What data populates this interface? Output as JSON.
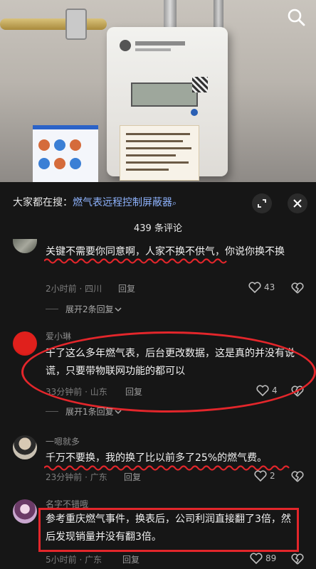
{
  "search_bar": {
    "prefix": "大家都在搜：",
    "query": "燃气表远程控制屏蔽器"
  },
  "comment_count": "439 条评论",
  "comments": [
    {
      "text": "关键不需要你同意啊，人家不换不供气，你说你换不换",
      "time_location": "2小时前 · 四川",
      "reply_label": "回复",
      "likes": "43",
      "expand_label": "展开2条回复"
    },
    {
      "user": "爱小琳",
      "text": "干了这么多年燃气表，后台更改数据，这是真的并没有说谎，只要带物联网功能的都可以",
      "time_location": "33分钟前 · 山东",
      "reply_label": "回复",
      "likes": "4",
      "expand_label": "展开1条回复"
    },
    {
      "user": "一嗯就多",
      "text": "千万不要换，我的换了比以前多了25%的燃气费。",
      "time_location": "23分钟前 · 广东",
      "reply_label": "回复",
      "likes": "2"
    },
    {
      "user": "名字不错哦",
      "text": "参考重庆燃气事件，换表后，公司利润直接翻了3倍，然后发现销量并没有翻3倍。",
      "time_location": "5小时前 · 广东",
      "reply_label": "回复",
      "likes": "89"
    }
  ],
  "colors": {
    "annotation_red": "#e3262b",
    "query_blue": "#8fb4ff",
    "background": "#161616"
  },
  "icons": [
    "search-icon",
    "expand-icon",
    "close-icon",
    "heart-icon",
    "broken-heart-icon",
    "chevron-down-icon"
  ]
}
